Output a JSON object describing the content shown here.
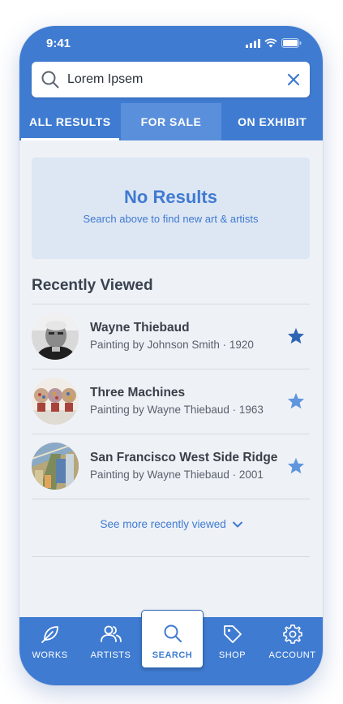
{
  "status_bar": {
    "time": "9:41"
  },
  "search": {
    "value": "Lorem Ipsem"
  },
  "tabs": [
    {
      "label": "ALL RESULTS",
      "active": true
    },
    {
      "label": "FOR SALE",
      "active": false
    },
    {
      "label": "ON EXHIBIT",
      "active": false
    }
  ],
  "empty_state": {
    "title": "No Results",
    "subtitle": "Search above to find new art & artists"
  },
  "recently_viewed": {
    "title": "Recently Viewed",
    "items": [
      {
        "title": "Wayne Thiebaud",
        "subtitle": "Painting by Johnson Smith ·  1920",
        "favorited": true
      },
      {
        "title": "Three Machines",
        "subtitle": "Painting by Wayne Thiebaud · 1963",
        "favorited": false
      },
      {
        "title": "San Francisco West Side Ridge",
        "subtitle": "Painting by Wayne Thiebaud · 2001",
        "favorited": false
      }
    ],
    "see_more": "See more recently viewed"
  },
  "bottom_nav": [
    {
      "label": "WORKS",
      "icon": "feather-icon"
    },
    {
      "label": "ARTISTS",
      "icon": "users-icon"
    },
    {
      "label": "SEARCH",
      "icon": "search-icon",
      "active": true
    },
    {
      "label": "SHOP",
      "icon": "tag-icon"
    },
    {
      "label": "ACCOUNT",
      "icon": "gear-icon"
    }
  ],
  "colors": {
    "primary": "#3f7bd1",
    "tab_highlight": "#5a8fdb",
    "empty_state_bg": "#dde6f3",
    "star_filled": "#2f64b3",
    "star_outline": "#5f96dd"
  }
}
